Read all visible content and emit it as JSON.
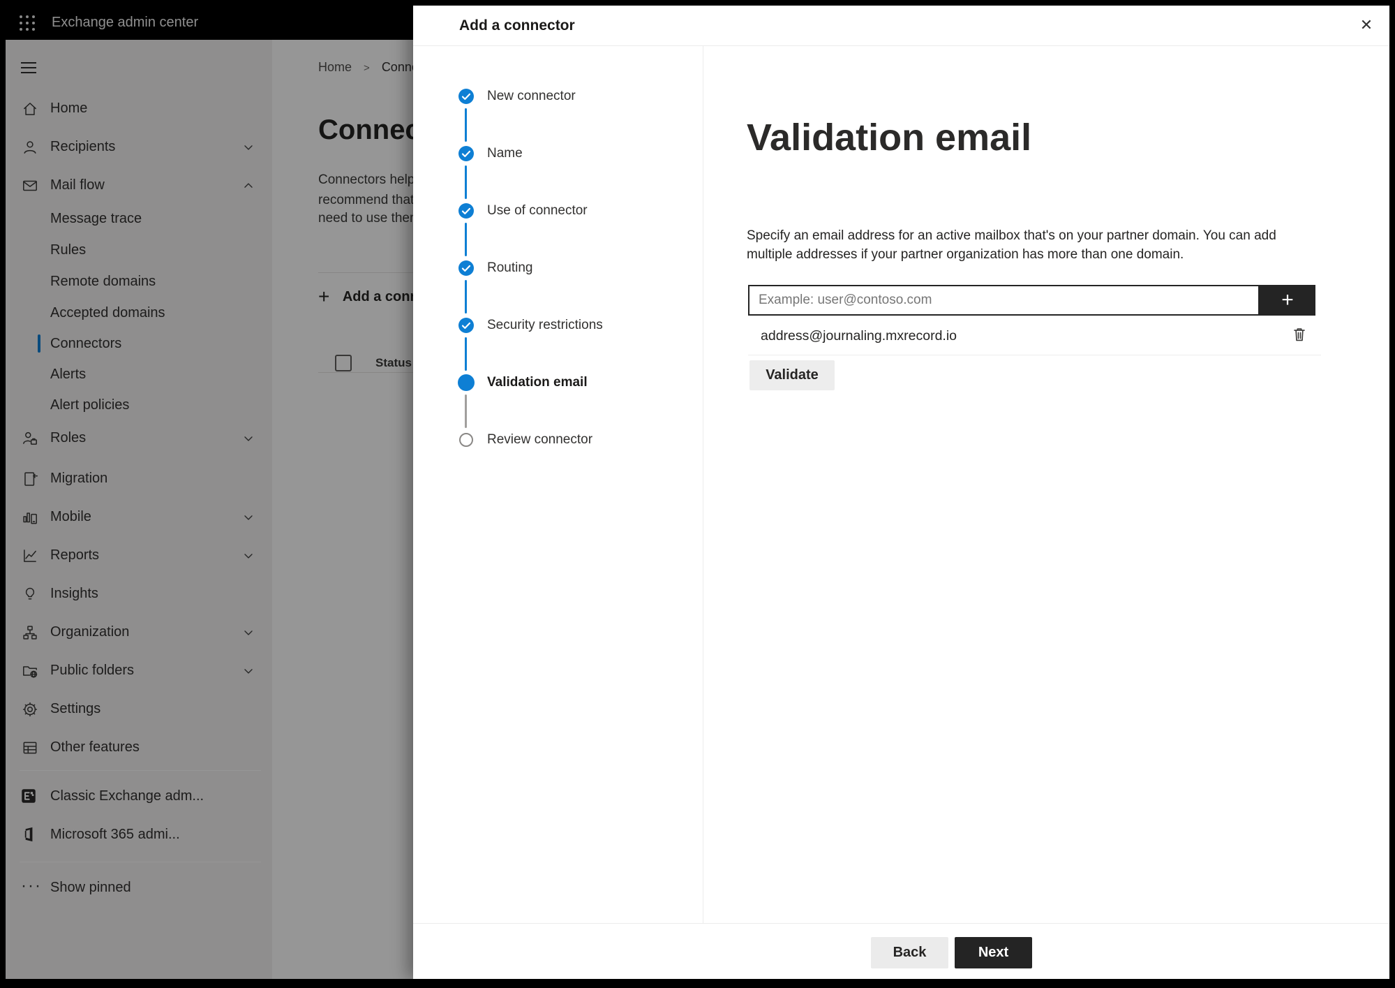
{
  "topbar": {
    "title": "Exchange admin center"
  },
  "icons": {
    "app_launcher": "waffle-grid",
    "close": "✕",
    "plus": "+",
    "ellipsis": "···",
    "breadcrumb_separator": ">"
  },
  "sidebar": {
    "items": [
      {
        "label": "Home",
        "icon": "home-icon"
      },
      {
        "label": "Recipients",
        "icon": "person-icon",
        "chevron": "down"
      },
      {
        "label": "Mail flow",
        "icon": "mail-icon",
        "chevron": "up",
        "expanded": true
      },
      {
        "label": "Message trace",
        "sub": true
      },
      {
        "label": "Rules",
        "sub": true
      },
      {
        "label": "Remote domains",
        "sub": true
      },
      {
        "label": "Accepted domains",
        "sub": true
      },
      {
        "label": "Connectors",
        "sub": true,
        "selected": true
      },
      {
        "label": "Alerts",
        "sub": true
      },
      {
        "label": "Alert policies",
        "sub": true
      },
      {
        "label": "Roles",
        "icon": "roles-icon",
        "chevron": "down"
      },
      {
        "label": "Migration",
        "icon": "migration-icon"
      },
      {
        "label": "Mobile",
        "icon": "mobile-icon",
        "chevron": "down"
      },
      {
        "label": "Reports",
        "icon": "reports-icon",
        "chevron": "down"
      },
      {
        "label": "Insights",
        "icon": "lightbulb-icon"
      },
      {
        "label": "Organization",
        "icon": "org-chart-icon",
        "chevron": "down"
      },
      {
        "label": "Public folders",
        "icon": "folder-globe-icon",
        "chevron": "down"
      },
      {
        "label": "Settings",
        "icon": "gear-icon"
      },
      {
        "label": "Other features",
        "icon": "table-icon"
      }
    ],
    "footer_items": [
      {
        "label": "Classic Exchange adm...",
        "icon": "exchange-logo-icon"
      },
      {
        "label": "Microsoft 365 admi...",
        "icon": "microsoft365-logo-icon"
      }
    ],
    "show_pinned_label": "Show pinned"
  },
  "page": {
    "breadcrumb": [
      "Home",
      "Connectors"
    ],
    "title": "Connectors",
    "description_lines": [
      "Connectors help",
      "recommend that",
      "need to use them"
    ],
    "add_button_label": "Add a connector",
    "table": {
      "column_status": "Status"
    }
  },
  "modal": {
    "title": "Add a connector",
    "steps": [
      {
        "label": "New connector",
        "state": "complete"
      },
      {
        "label": "Name",
        "state": "complete"
      },
      {
        "label": "Use of connector",
        "state": "complete"
      },
      {
        "label": "Routing",
        "state": "complete"
      },
      {
        "label": "Security restrictions",
        "state": "complete"
      },
      {
        "label": "Validation email",
        "state": "current"
      },
      {
        "label": "Review connector",
        "state": "upcoming"
      }
    ],
    "content": {
      "heading": "Validation email",
      "description": "Specify an email address for an active mailbox that's on your partner domain. You can add multiple addresses if your partner organization has more than one domain.",
      "email_input": {
        "value": "",
        "placeholder": "Example: user@contoso.com"
      },
      "addresses": [
        {
          "email": "address@journaling.mxrecord.io"
        }
      ],
      "validate_button_label": "Validate"
    },
    "footer": {
      "back_label": "Back",
      "next_label": "Next"
    }
  },
  "colors": {
    "accent_blue": "#0e7fd4",
    "dark_button": "#242424",
    "sidebar_bg": "#f3f2f1",
    "overlay": "rgba(0,0,0,0.41)"
  }
}
